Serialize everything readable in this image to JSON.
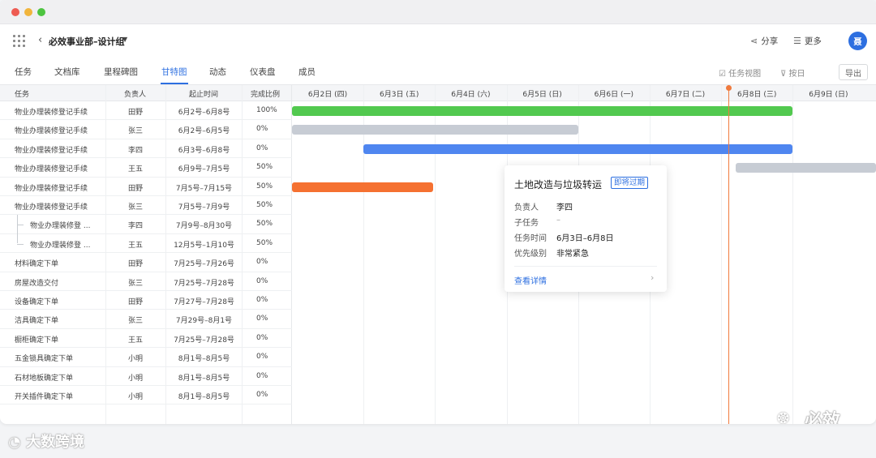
{
  "header": {
    "project_title": "必效事业部–设计组",
    "share_label": "分享",
    "more_label": "更多",
    "avatar_text": "聂"
  },
  "tabs": [
    {
      "label": "任务"
    },
    {
      "label": "文档库"
    },
    {
      "label": "里程碑图"
    },
    {
      "label": "甘特图",
      "active": true
    },
    {
      "label": "动态"
    },
    {
      "label": "仪表盘"
    },
    {
      "label": "成员"
    }
  ],
  "toolbar": {
    "task_view_label": "任务视图",
    "by_day_label": "按日",
    "export_label": "导出"
  },
  "table": {
    "columns": [
      "任务",
      "负责人",
      "起止时间",
      "完成比例"
    ],
    "rows": [
      {
        "task": "物业办理装修登记手续",
        "owner": "田野",
        "range": "6月2号–6月8号",
        "pct": "100%"
      },
      {
        "task": "物业办理装修登记手续",
        "owner": "张三",
        "range": "6月2号–6月5号",
        "pct": "0%"
      },
      {
        "task": "物业办理装修登记手续",
        "owner": "李四",
        "range": "6月3号–6月8号",
        "pct": "0%"
      },
      {
        "task": "物业办理装修登记手续",
        "owner": "王五",
        "range": "6月9号–7月5号",
        "pct": "50%"
      },
      {
        "task": "物业办理装修登记手续",
        "owner": "田野",
        "range": "7月5号–7月15号",
        "pct": "50%"
      },
      {
        "task": "物业办理装修登记手续",
        "owner": "张三",
        "range": "7月5号–7月9号",
        "pct": "50%"
      },
      {
        "task": "物业办理装修登 ...",
        "owner": "李四",
        "range": "7月9号–8月30号",
        "pct": "50%",
        "child": true
      },
      {
        "task": "物业办理装修登 ...",
        "owner": "王五",
        "range": "12月5号–1月10号",
        "pct": "50%",
        "child": true
      },
      {
        "task": "材料确定下单",
        "owner": "田野",
        "range": "7月25号–7月26号",
        "pct": "0%"
      },
      {
        "task": "房屋改造交付",
        "owner": "张三",
        "range": "7月25号–7月28号",
        "pct": "0%"
      },
      {
        "task": "设备确定下单",
        "owner": "田野",
        "range": "7月27号–7月28号",
        "pct": "0%"
      },
      {
        "task": "洁具确定下单",
        "owner": "张三",
        "range": "7月29号–8月1号",
        "pct": "0%"
      },
      {
        "task": "橱柜确定下单",
        "owner": "王五",
        "range": "7月25号–7月28号",
        "pct": "0%"
      },
      {
        "task": "五金锁具确定下单",
        "owner": "小明",
        "range": "8月1号–8月5号",
        "pct": "0%"
      },
      {
        "task": "石材地板确定下单",
        "owner": "小明",
        "range": "8月1号–8月5号",
        "pct": "0%"
      },
      {
        "task": "开关插件确定下单",
        "owner": "小明",
        "range": "8月1号–8月5号",
        "pct": "0%"
      }
    ]
  },
  "gantt": {
    "days": [
      "6月2日 (四)",
      "6月3日 (五)",
      "6月4日 (六)",
      "6月5日 (日)",
      "6月6日 (一)",
      "6月7日 (二)",
      "6月8日 (三)",
      "6月9日 (日)"
    ],
    "today_index": 6,
    "bars": [
      {
        "row": 0,
        "start_day": 0,
        "end_day": 7.0,
        "color": "#52c94f"
      },
      {
        "row": 1,
        "start_day": 0,
        "end_day": 4.0,
        "color": "#c7ccd4"
      },
      {
        "row": 2,
        "start_day": 1,
        "end_day": 7.0,
        "color": "#4f86f0"
      },
      {
        "row": 3,
        "start_day": 6.2,
        "end_day": 8.2,
        "color": "#c7ccd4"
      },
      {
        "row": 4,
        "start_day": 0,
        "end_day": 1.97,
        "color": "#f57131"
      }
    ],
    "today_color": "#f07a3d"
  },
  "popover": {
    "title": "土地改造与垃圾转运",
    "badge": "即将过期",
    "fields": [
      {
        "label": "负责人",
        "value": "李四"
      },
      {
        "label": "子任务",
        "value": "–"
      },
      {
        "label": "任务时间",
        "value": "6月3日–6月8日"
      },
      {
        "label": "优先级别",
        "value": "非常紧急"
      }
    ],
    "link_label": "查看详情"
  },
  "watermarks": {
    "left": "大数跨境",
    "right": "必效"
  },
  "colors": {
    "accent": "#2d6fe0"
  }
}
